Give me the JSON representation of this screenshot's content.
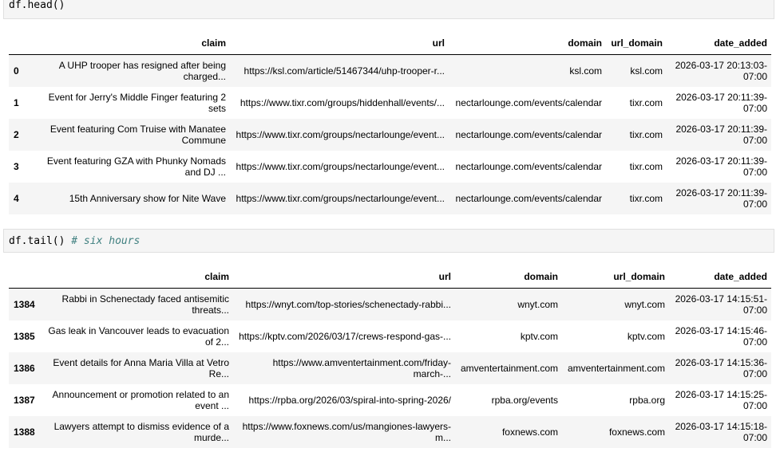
{
  "cell1": {
    "code": "df.head()"
  },
  "cell2": {
    "code": "df.tail()",
    "comment": "# six hours"
  },
  "head_table": {
    "columns": [
      "claim",
      "url",
      "domain",
      "url_domain",
      "date_added"
    ],
    "rows": [
      {
        "index": "0",
        "claim": "A UHP trooper has resigned after being charged...",
        "url": "https://ksl.com/article/51467344/uhp-trooper-r...",
        "domain": "ksl.com",
        "url_domain": "ksl.com",
        "date_added": "2026-03-17 20:13:03-07:00"
      },
      {
        "index": "1",
        "claim": "Event for Jerry's Middle Finger featuring 2 sets",
        "url": "https://www.tixr.com/groups/hiddenhall/events/...",
        "domain": "nectarlounge.com/events/calendar",
        "url_domain": "tixr.com",
        "date_added": "2026-03-17 20:11:39-07:00"
      },
      {
        "index": "2",
        "claim": "Event featuring Com Truise with Manatee Commune",
        "url": "https://www.tixr.com/groups/nectarlounge/event...",
        "domain": "nectarlounge.com/events/calendar",
        "url_domain": "tixr.com",
        "date_added": "2026-03-17 20:11:39-07:00"
      },
      {
        "index": "3",
        "claim": "Event featuring GZA with Phunky Nomads and DJ ...",
        "url": "https://www.tixr.com/groups/nectarlounge/event...",
        "domain": "nectarlounge.com/events/calendar",
        "url_domain": "tixr.com",
        "date_added": "2026-03-17 20:11:39-07:00"
      },
      {
        "index": "4",
        "claim": "15th Anniversary show for Nite Wave",
        "url": "https://www.tixr.com/groups/nectarlounge/event...",
        "domain": "nectarlounge.com/events/calendar",
        "url_domain": "tixr.com",
        "date_added": "2026-03-17 20:11:39-07:00"
      }
    ]
  },
  "tail_table": {
    "columns": [
      "claim",
      "url",
      "domain",
      "url_domain",
      "date_added"
    ],
    "rows": [
      {
        "index": "1384",
        "claim": "Rabbi in Schenectady faced antisemitic threats...",
        "url": "https://wnyt.com/top-stories/schenectady-rabbi...",
        "domain": "wnyt.com",
        "url_domain": "wnyt.com",
        "date_added": "2026-03-17 14:15:51-07:00"
      },
      {
        "index": "1385",
        "claim": "Gas leak in Vancouver leads to evacuation of 2...",
        "url": "https://kptv.com/2026/03/17/crews-respond-gas-...",
        "domain": "kptv.com",
        "url_domain": "kptv.com",
        "date_added": "2026-03-17 14:15:46-07:00"
      },
      {
        "index": "1386",
        "claim": "Event details for Anna Maria Villa at Vetro Re...",
        "url": "https://www.amventertainment.com/friday-march-...",
        "domain": "amventertainment.com",
        "url_domain": "amventertainment.com",
        "date_added": "2026-03-17 14:15:36-07:00"
      },
      {
        "index": "1387",
        "claim": "Announcement or promotion related to an event ...",
        "url": "https://rpba.org/2026/03/spiral-into-spring-2026/",
        "domain": "rpba.org/events",
        "url_domain": "rpba.org",
        "date_added": "2026-03-17 14:15:25-07:00"
      },
      {
        "index": "1388",
        "claim": "Lawyers attempt to dismiss evidence of a murde...",
        "url": "https://www.foxnews.com/us/mangiones-lawyers-m...",
        "domain": "foxnews.com",
        "url_domain": "foxnews.com",
        "date_added": "2026-03-17 14:15:18-07:00"
      }
    ]
  }
}
